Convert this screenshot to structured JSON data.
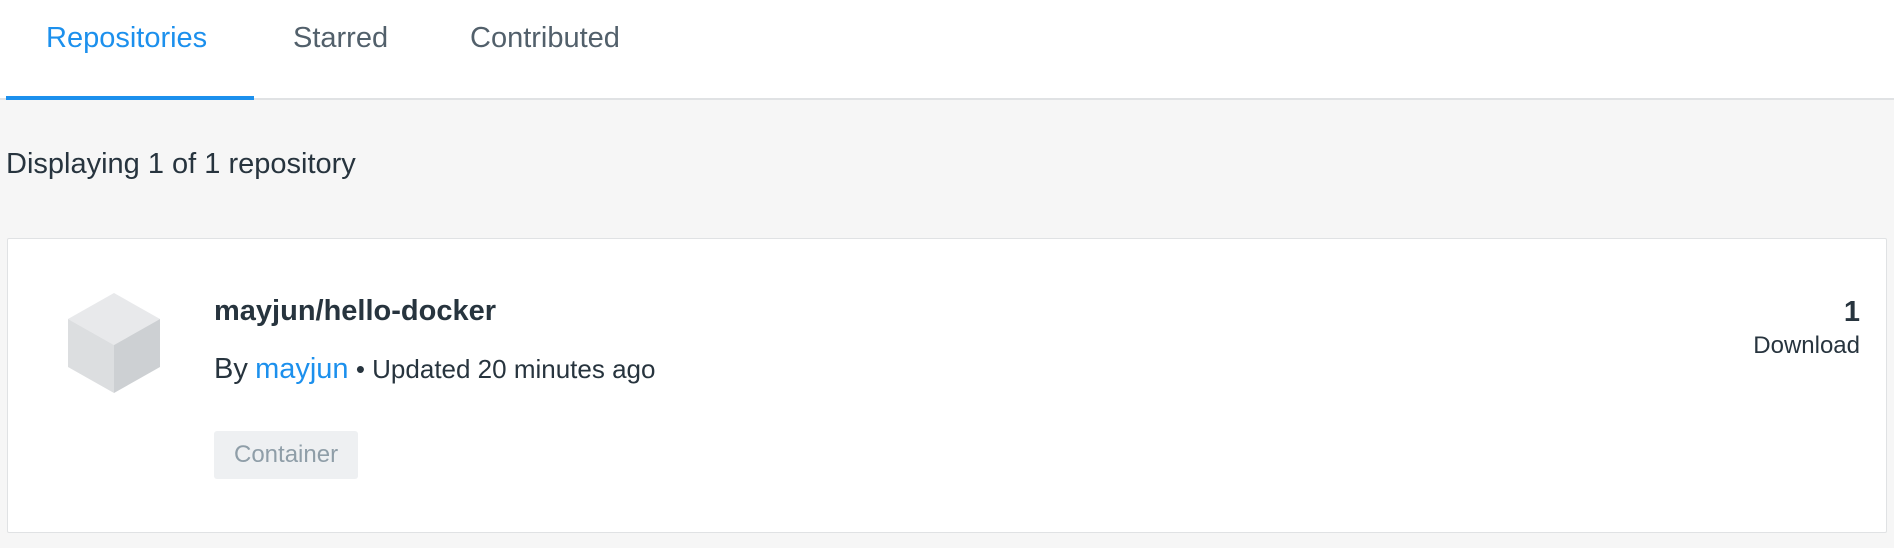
{
  "tabs": [
    {
      "label": "Repositories",
      "active": true
    },
    {
      "label": "Starred",
      "active": false
    },
    {
      "label": "Contributed",
      "active": false
    }
  ],
  "summary": "Displaying 1 of 1 repository",
  "repository": {
    "name": "mayjun/hello-docker",
    "by_label": "By",
    "owner": "mayjun",
    "separator": "•",
    "updated": "Updated 20 minutes ago",
    "type_badge": "Container",
    "downloads_count": "1",
    "downloads_label": "Download",
    "icon": "cube-icon"
  },
  "colors": {
    "accent": "#1c90ed",
    "background": "#f6f6f6",
    "card": "#ffffff",
    "text": "#27343e",
    "muted": "#8f9ea8"
  }
}
